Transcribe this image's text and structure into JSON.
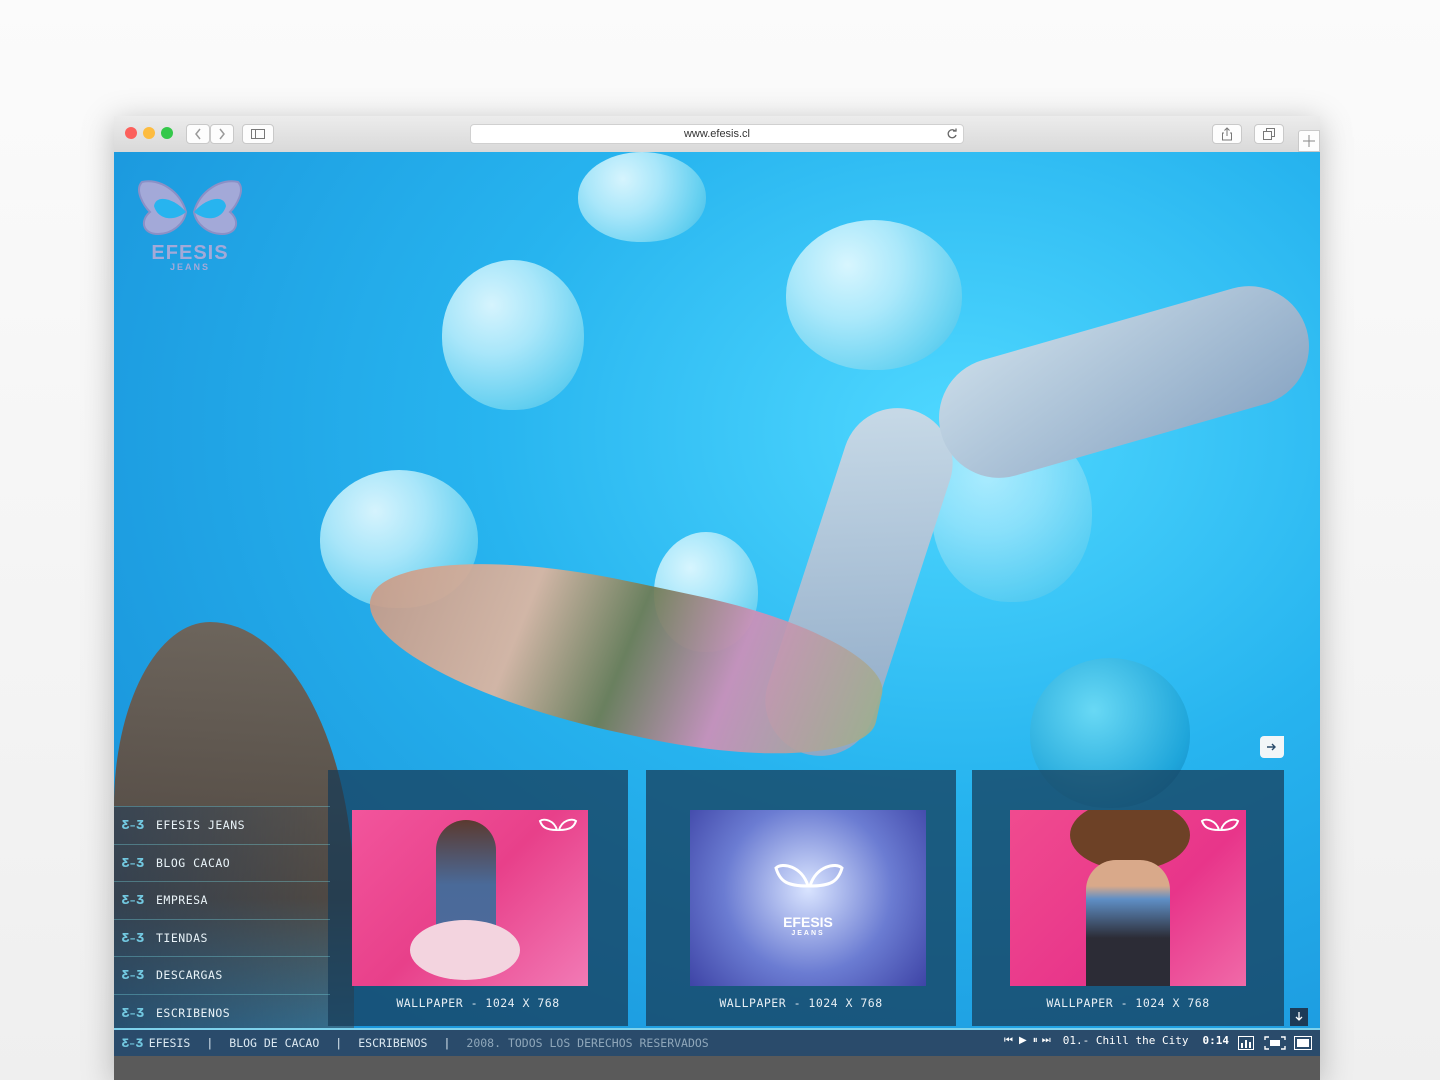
{
  "browser": {
    "url": "www.efesis.cl"
  },
  "logo": {
    "brand": "EFESIS",
    "sub": "JEANS"
  },
  "nav": {
    "items": [
      {
        "label": "EFESIS JEANS"
      },
      {
        "label": "BLOG CACAO"
      },
      {
        "label": "EMPRESA"
      },
      {
        "label": "TIENDAS"
      },
      {
        "label": "DESCARGAS"
      },
      {
        "label": "ESCRIBENOS"
      }
    ]
  },
  "wallpapers": [
    {
      "caption": "WALLPAPER - 1024 X 768"
    },
    {
      "caption": "WALLPAPER - 1024 X 768"
    },
    {
      "caption": "WALLPAPER - 1024 X 768"
    }
  ],
  "footer": {
    "home": "EFESIS",
    "blog": "BLOG DE CACAO",
    "contact": "ESCRIBENOS",
    "copyright": "2008. TODOS LOS DERECHOS RESERVADOS",
    "separator": "|"
  },
  "player": {
    "track": "01.- Chill the City",
    "time": "0:14"
  },
  "colors": {
    "accent": "#7ed2ec",
    "panel": "#163a56"
  }
}
